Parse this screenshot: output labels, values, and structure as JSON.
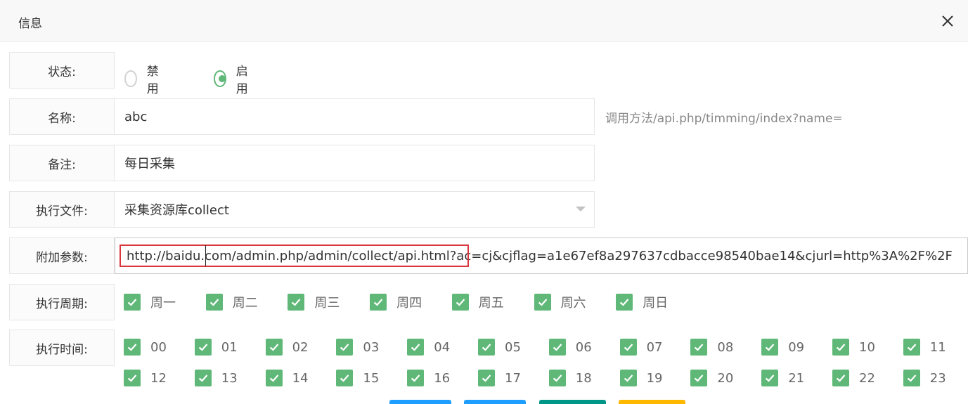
{
  "dialog": {
    "title": "信息"
  },
  "status": {
    "label": "状态:",
    "options": [
      "禁用",
      "启用"
    ],
    "selected": "启用"
  },
  "name": {
    "label": "名称:",
    "value": "abc",
    "hint": "调用方法/api.php/timming/index?name="
  },
  "remark": {
    "label": "备注:",
    "value": "每日采集"
  },
  "exec_file": {
    "label": "执行文件:",
    "value": "采集资源库collect"
  },
  "params": {
    "label": "附加参数:",
    "value": "http://baidu.com/admin.php/admin/collect/api.html?ac=cj&cjflag=a1e67ef8a297637cdbacce98540bae14&cjurl=http%3A%2F%2F"
  },
  "period": {
    "label": "执行周期:",
    "days": [
      "周一",
      "周二",
      "周三",
      "周四",
      "周五",
      "周六",
      "周日"
    ]
  },
  "time": {
    "label": "执行时间:",
    "hours": [
      "00",
      "01",
      "02",
      "03",
      "04",
      "05",
      "06",
      "07",
      "08",
      "09",
      "10",
      "11",
      "12",
      "13",
      "14",
      "15",
      "16",
      "17",
      "18",
      "19",
      "20",
      "21",
      "22",
      "23"
    ]
  },
  "colors": {
    "accent": "#5fb878",
    "highlight": "#d9363e",
    "btn_blue": "#1e9fff",
    "btn_teal": "#009688",
    "btn_yellow": "#ffb800"
  }
}
